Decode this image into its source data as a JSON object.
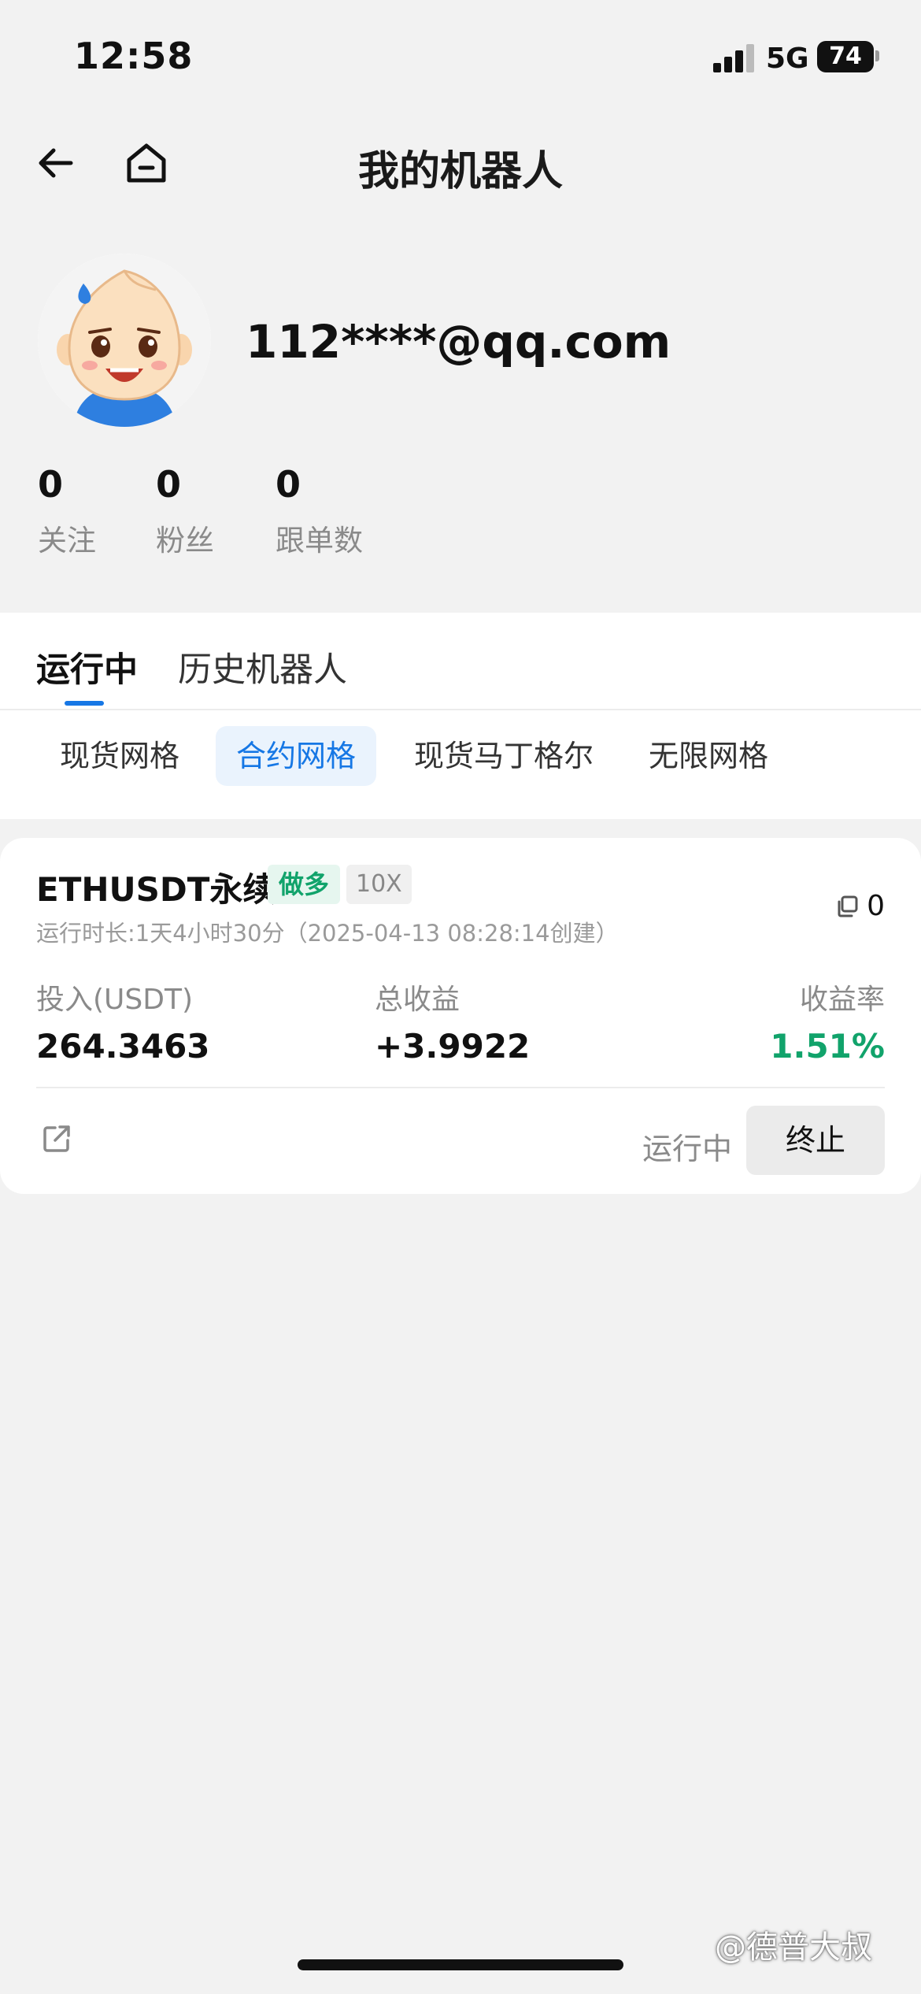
{
  "status_bar": {
    "time": "12:58",
    "network": "5G",
    "battery": "74"
  },
  "header": {
    "title": "我的机器人"
  },
  "profile": {
    "email": "112****@qq.com",
    "stats": [
      {
        "value": "0",
        "label": "关注"
      },
      {
        "value": "0",
        "label": "粉丝"
      },
      {
        "value": "0",
        "label": "跟单数"
      }
    ]
  },
  "tabs": {
    "running": "运行中",
    "history": "历史机器人"
  },
  "sub_tabs": [
    "现货网格",
    "合约网格",
    "现货马丁格尔",
    "无限网格"
  ],
  "bot": {
    "pair": "ETHUSDT永续",
    "direction": "做多",
    "leverage": "10X",
    "runtime": "运行时长:1天4小时30分（2025-04-13 08:28:14创建）",
    "copy_count": "0",
    "invest_label": "投入(USDT)",
    "invest_value": "264.3463",
    "pnl_label": "总收益",
    "pnl_value": "+3.9922",
    "rate_label": "收益率",
    "rate_value": "1.51%",
    "status": "运行中",
    "stop_label": "终止"
  },
  "watermark": "@德普大叔",
  "colors": {
    "accent": "#1677e5",
    "profit": "#11a36b",
    "background": "#f2f2f2"
  },
  "icons": [
    "back-arrow-icon",
    "home-icon",
    "copy-icon",
    "share-icon"
  ]
}
